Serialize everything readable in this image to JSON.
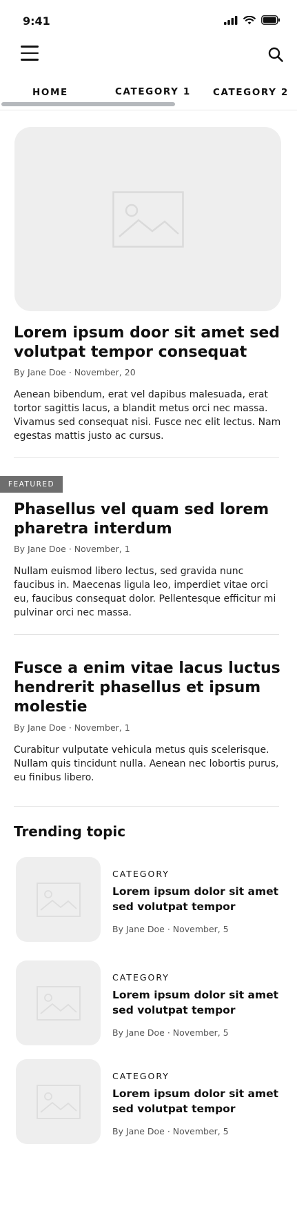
{
  "status_bar": {
    "time": "9:41"
  },
  "tabs": [
    {
      "label": "HOME"
    },
    {
      "label": "CATEGORY 1"
    },
    {
      "label": "CATEGORY 2"
    }
  ],
  "articles": [
    {
      "headline": "Lorem ipsum door sit amet sed volutpat tempor consequat",
      "byline": "By Jane Doe · November, 20",
      "excerpt": "Aenean bibendum, erat vel dapibus malesuada, erat tortor sagittis lacus, a blandit metus orci nec massa. Vivamus sed consequat nisi. Fusce nec elit lectus. Nam egestas mattis justo ac cursus."
    },
    {
      "badge": "FEATURED",
      "headline": "Phasellus vel quam sed lorem pharetra interdum",
      "byline": "By Jane Doe · November, 1",
      "excerpt": "Nullam euismod libero lectus, sed gravida nunc faucibus in. Maecenas ligula leo, imperdiet vitae orci eu, faucibus consequat dolor. Pellentesque efficitur mi pulvinar orci nec massa."
    },
    {
      "headline": "Fusce a enim vitae lacus luctus hendrerit phasellus et ipsum molestie",
      "byline": "By Jane Doe · November, 1",
      "excerpt": "Curabitur vulputate vehicula metus quis scelerisque. Nullam quis tincidunt nulla. Aenean nec lobortis purus, eu finibus libero."
    }
  ],
  "trending": {
    "title": "Trending topic",
    "items": [
      {
        "category": "CATEGORY",
        "headline": "Lorem ipsum dolor sit amet sed volutpat tempor",
        "byline": "By Jane Doe · November, 5"
      },
      {
        "category": "CATEGORY",
        "headline": "Lorem ipsum dolor sit amet sed volutpat tempor",
        "byline": "By Jane Doe · November, 5"
      },
      {
        "category": "CATEGORY",
        "headline": "Lorem ipsum dolor sit amet sed volutpat tempor",
        "byline": "By Jane Doe · November, 5"
      }
    ]
  },
  "colors": {
    "text": "#111111",
    "muted": "#555555",
    "placeholder": "#eeeeee",
    "badge": "#6e6e6e",
    "scrollbar": "#b5b8bc"
  },
  "icons": [
    "signal-icon",
    "wifi-icon",
    "battery-icon",
    "menu-icon",
    "search-icon",
    "image-placeholder-icon"
  ]
}
